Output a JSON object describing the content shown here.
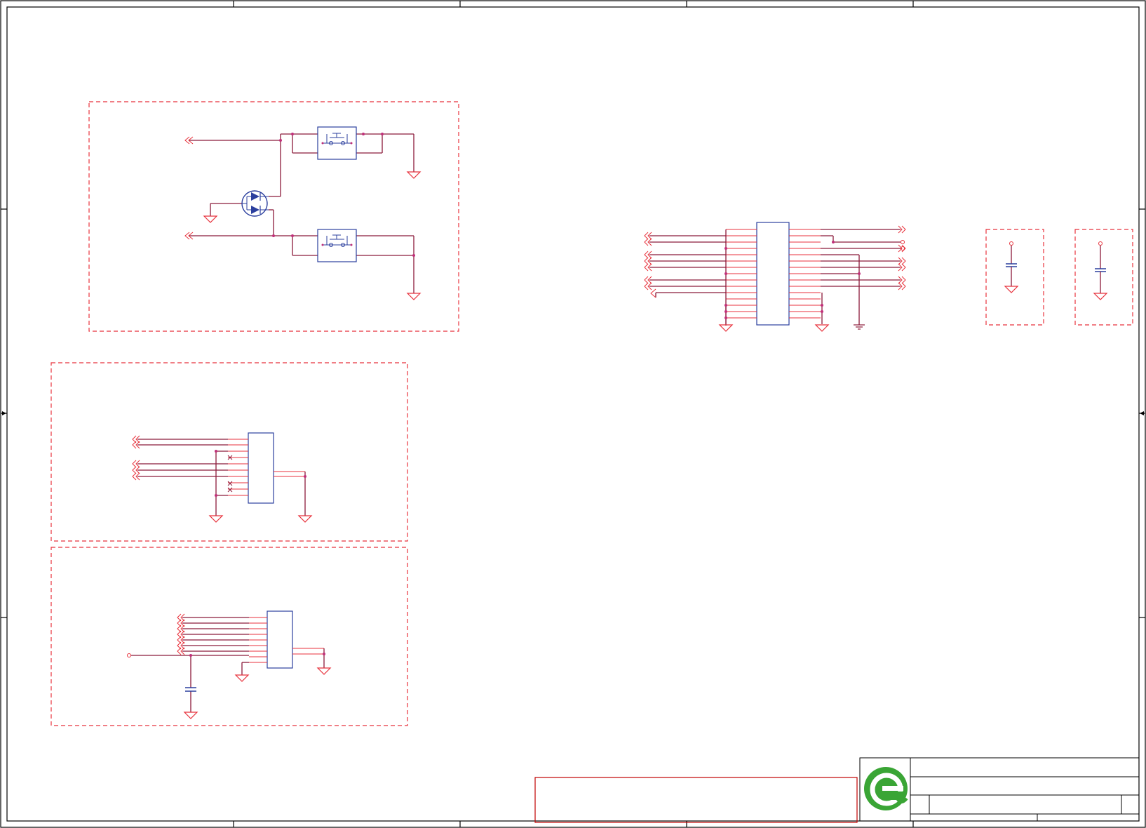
{
  "document": {
    "kind": "schematic-sheet",
    "colors": {
      "border": "#000000",
      "wire": "#8b1a3a",
      "pin": "#e8323c",
      "component": "#2b3f9e",
      "junction": "#c0307a",
      "group_box": "#e8323c",
      "logo": "#3aa535"
    }
  },
  "groups": [
    {
      "id": "button-diode-circuit",
      "label": ""
    },
    {
      "id": "connector-circuit-1",
      "label": ""
    },
    {
      "id": "connector-circuit-2",
      "label": ""
    },
    {
      "id": "decoupling-cap-1",
      "label": ""
    },
    {
      "id": "decoupling-cap-2",
      "label": ""
    }
  ],
  "title_block": {
    "logo_icon": "green-e-logo-icon",
    "title": "",
    "sheet_number": "",
    "revision": ""
  },
  "note_box": {
    "text": ""
  }
}
